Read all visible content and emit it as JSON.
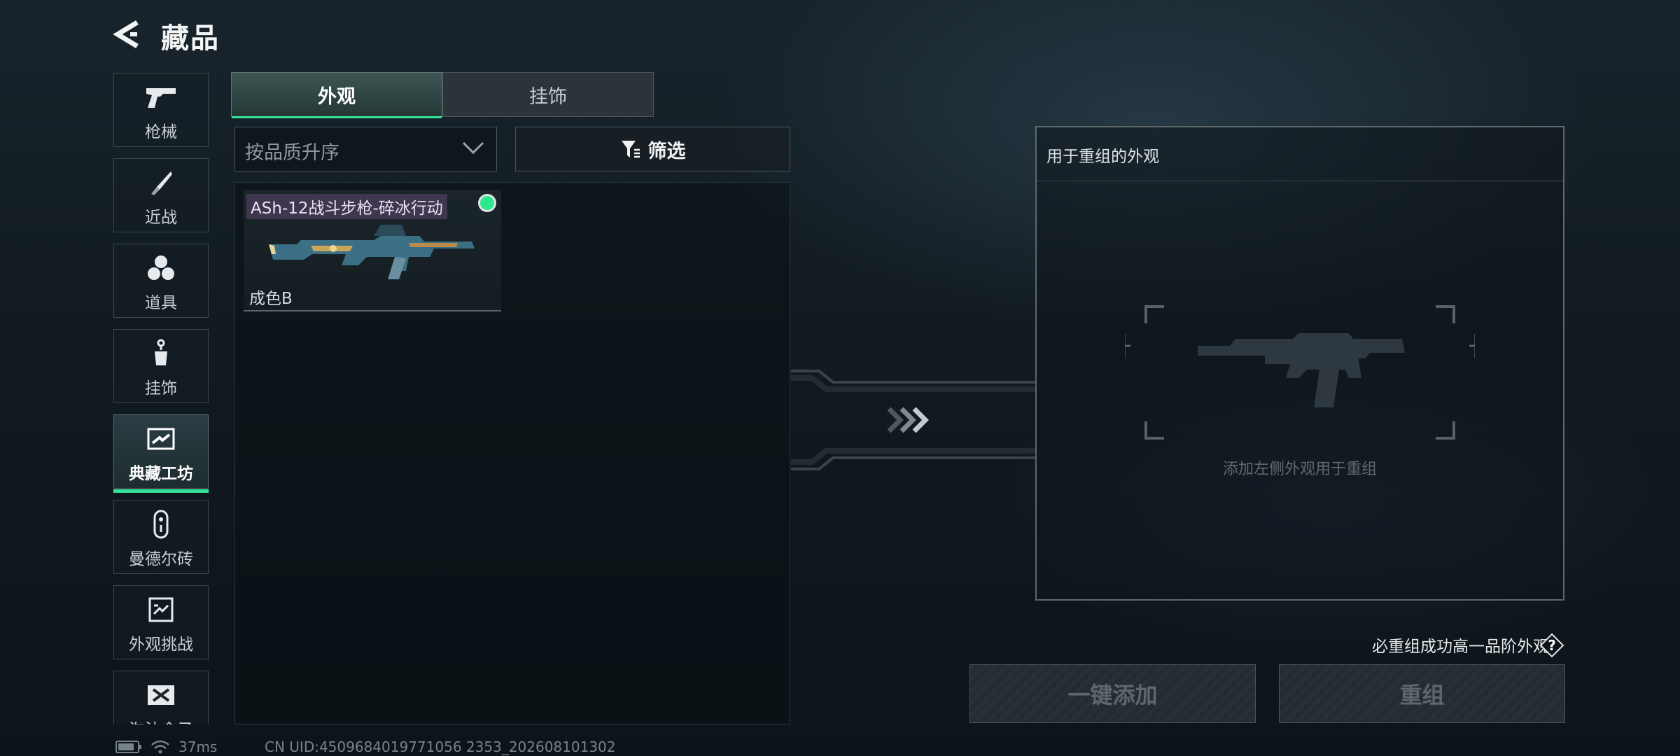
{
  "header": {
    "title": "藏品"
  },
  "sidebar": {
    "items": [
      {
        "label": "枪械",
        "icon": "pistol-icon"
      },
      {
        "label": "近战",
        "icon": "knife-icon"
      },
      {
        "label": "道具",
        "icon": "grenades-icon"
      },
      {
        "label": "挂饰",
        "icon": "charm-icon"
      },
      {
        "label": "典藏工坊",
        "icon": "workshop-icon",
        "active": true
      },
      {
        "label": "曼德尔砖",
        "icon": "brick-icon"
      },
      {
        "label": "外观挑战",
        "icon": "challenge-icon"
      },
      {
        "label": "淘汰余子",
        "icon": "elimination-icon"
      }
    ]
  },
  "tabs": [
    {
      "label": "外观",
      "active": true
    },
    {
      "label": "挂饰",
      "active": false
    }
  ],
  "sort": {
    "label": "按品质升序"
  },
  "filter": {
    "label": "筛选"
  },
  "items": [
    {
      "name": "ASh-12战斗步枪-碎冰行动",
      "wear": "成色B",
      "equipped": true
    }
  ],
  "right_panel": {
    "title": "用于重组的外观",
    "placeholder": "添加左侧外观用于重组"
  },
  "footer": {
    "rule_text": "必重组成功高一品阶外观",
    "help": "?",
    "add_button": "一键添加",
    "recombine_button": "重组"
  },
  "status": {
    "ping": "37ms",
    "uid": "CN UID:4509684019771056 2353_202608101302"
  },
  "colors": {
    "accent": "#35e59a",
    "name_tag": "#3f3650"
  }
}
